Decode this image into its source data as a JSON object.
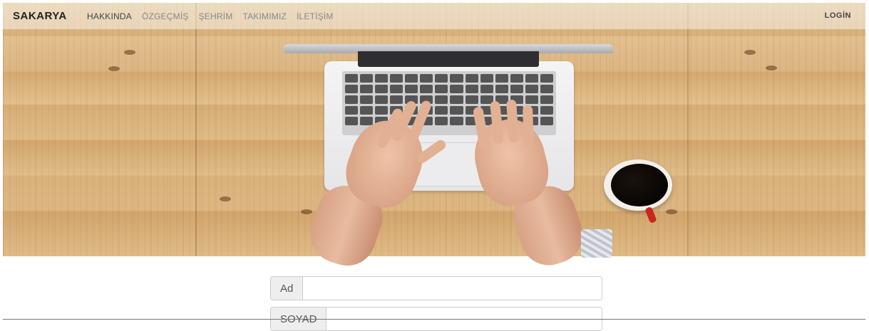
{
  "navbar": {
    "brand": "SAKARYA",
    "links": [
      "HAKKINDA",
      "ÖZGEÇMİŞ",
      "ŞEHRİM",
      "TAKIMIMIZ",
      "İLETİŞİM"
    ],
    "login": "LOGİN"
  },
  "form": {
    "ad_label": "Ad",
    "ad_value": "",
    "soyad_label": "SOYAD",
    "soyad_value": ""
  }
}
